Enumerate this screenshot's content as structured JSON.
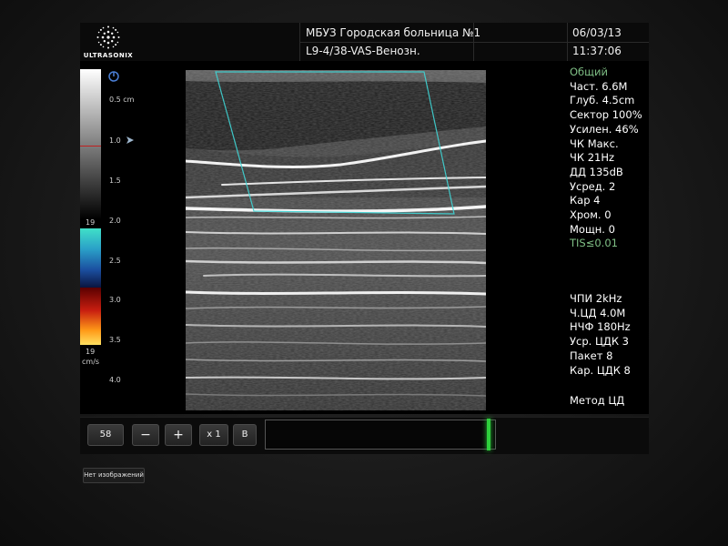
{
  "header": {
    "brand": "ULTRASONIX",
    "hospital": "МБУЗ Городская больница №1",
    "probe": "L9-4/38-VAS-Венозн.",
    "date": "06/03/13",
    "time": "11:37:06"
  },
  "scale": {
    "top_value": "19",
    "bottom_value": "19",
    "unit": "cm/s",
    "depth_ticks": [
      "0.5 cm",
      "1.0",
      "1.5",
      "2.0",
      "2.5",
      "3.0",
      "3.5",
      "4.0"
    ]
  },
  "params": {
    "mode": "Общий",
    "lines": [
      "Част. 6.6M",
      "Глуб. 4.5cm",
      "Сектор 100%",
      "Усилен. 46%",
      "ЧК Макс.",
      "ЧК 21Hz",
      "ДД 135dB",
      "Усред. 2",
      "Кар 4",
      "Хром. 0",
      "Мощн. 0"
    ],
    "tis": "TIS≤0.01",
    "doppler_lines": [
      "ЧПИ 2kHz",
      "Ч.ЦД 4.0M",
      "НЧФ 180Hz",
      "Уср. ЦДК 3",
      "Пакет 8",
      "Кар. ЦДК 8"
    ],
    "method": "Метод ЦД"
  },
  "toolbar": {
    "frame_number": "58",
    "minus": "−",
    "plus": "+",
    "zoom": "x 1",
    "mode_b": "B",
    "slider_position": 0.98
  },
  "footer": {
    "no_images": "Нет изображений"
  },
  "colors": {
    "accent_green": "#2ecf3c",
    "roi_cyan": "#3fd6d6",
    "param_green": "#7fbf85"
  }
}
